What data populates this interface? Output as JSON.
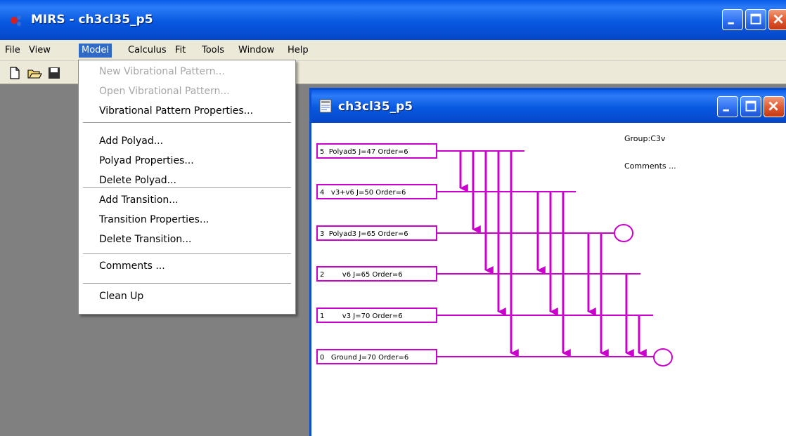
{
  "window": {
    "title": "MIRS - ch3cl35_p5"
  },
  "menubar": {
    "items": [
      "File",
      "View",
      "Model",
      "Calculus",
      "Fit",
      "Tools",
      "Window",
      "Help"
    ],
    "active": "Model"
  },
  "toolbar": {
    "icons": [
      "new-file-icon",
      "open-folder-icon",
      "save-icon"
    ]
  },
  "model_menu": {
    "groups": [
      [
        {
          "label": "New Vibrational Pattern...",
          "enabled": false
        },
        {
          "label": "Open Vibrational Pattern...",
          "enabled": false
        },
        {
          "label": "Vibrational Pattern Properties...",
          "enabled": true
        }
      ],
      [
        {
          "label": "Add Polyad...",
          "enabled": true
        },
        {
          "label": "Polyad Properties...",
          "enabled": true
        },
        {
          "label": "Delete Polyad...",
          "enabled": true
        }
      ],
      [
        {
          "label": "Add Transition...",
          "enabled": true
        },
        {
          "label": "Transition Properties...",
          "enabled": true
        },
        {
          "label": "Delete Transition...",
          "enabled": true
        }
      ],
      [
        {
          "label": "Comments ...",
          "enabled": true
        }
      ],
      [
        {
          "label": "Clean Up",
          "enabled": true
        }
      ]
    ]
  },
  "child_window": {
    "title": "ch3cl35_p5",
    "group_label": "Group:C3v",
    "comments_label": "Comments ...",
    "diagram_color": "#cc00cc",
    "polyads": [
      {
        "label": "5  Polyad5 J=47 Order=6"
      },
      {
        "label": "4   v3+v6 J=50 Order=6"
      },
      {
        "label": "3  Polyad3 J=65 Order=6"
      },
      {
        "label": "2        v6 J=65 Order=6"
      },
      {
        "label": "1        v3 J=70 Order=6"
      },
      {
        "label": "0   Ground J=70 Order=6"
      }
    ]
  },
  "colors": {
    "titlebar": "#0858e0",
    "menu_highlight": "#316ac5",
    "magenta": "#cc00cc",
    "workspace": "#808080"
  }
}
